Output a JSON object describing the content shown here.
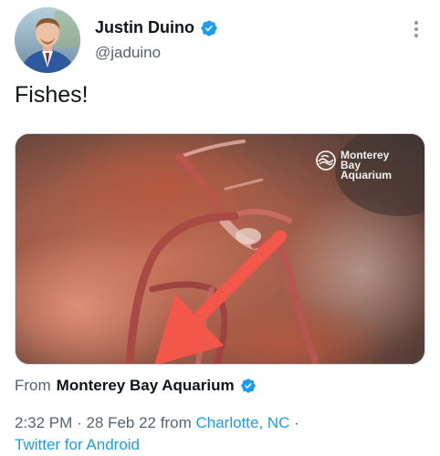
{
  "user": {
    "display_name": "Justin Duino",
    "handle": "@jaduino",
    "verified": true
  },
  "tweet": {
    "text": "Fishes!"
  },
  "media": {
    "watermark_line1": "Monterey Bay",
    "watermark_line2": "Aquarium"
  },
  "attribution": {
    "from_label": "From",
    "source_name": "Monterey Bay Aquarium",
    "verified": true
  },
  "meta": {
    "time": "2:32 PM",
    "separator": "·",
    "date": "28 Feb 22",
    "from_word": "from",
    "location": "Charlotte, NC",
    "client": "Twitter for Android"
  },
  "colors": {
    "verified_blue": "#1d9bf0",
    "link_blue": "#1d9bf0",
    "secondary_text": "#536471",
    "annotation_arrow": "#f2574a"
  },
  "icons": {
    "verified": "verified-badge-icon",
    "more": "more-options-icon",
    "watermark": "monterey-bay-aquarium-logo"
  }
}
